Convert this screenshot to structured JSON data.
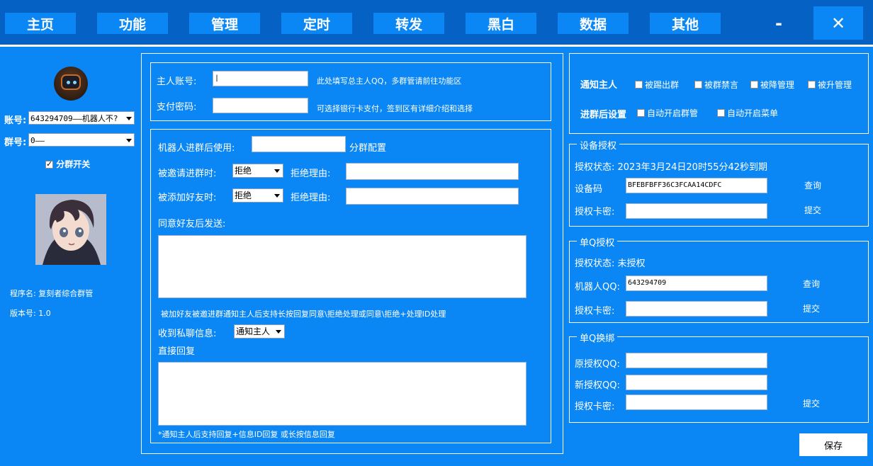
{
  "nav": {
    "tabs": [
      "主页",
      "功能",
      "管理",
      "定时",
      "转发",
      "黑白",
      "数据",
      "其他"
    ],
    "minimize": "-",
    "close": "✕"
  },
  "sidebar": {
    "account_label": "账号:",
    "account_value": "643294709——机器人不?",
    "group_label": "群号:",
    "group_value": "0——",
    "split_switch_label": "分群开关",
    "program_name": "程序名: 复刻者综合群管",
    "version": "版本号: 1.0"
  },
  "owner": {
    "account_label": "主人账号:",
    "account_value": "|",
    "account_hint": "此处填写总主人QQ，多群管请前往功能区",
    "pay_label": "支付密码:",
    "pay_value": "",
    "pay_hint": "可选择银行卡支付，签到区有详细介绍和选择"
  },
  "robot": {
    "after_join_label": "机器人进群后使用:",
    "after_join_value": "",
    "split_config": "分群配置",
    "invited_label": "被邀请进群时:",
    "invited_value": "拒绝",
    "invited_reason_label": "拒绝理由:",
    "invited_reason_value": "",
    "added_label": "被添加好友时:",
    "added_value": "拒绝",
    "added_reason_label": "拒绝理由:",
    "added_reason_value": "",
    "after_agree_label": "同意好友后发送:",
    "after_agree_value": "",
    "hint1": "被加好友被邀进群通知主人后支持长按回复同意\\拒绝处理或同意\\拒绝+处理ID处理",
    "private_msg_label": "收到私聊信息:",
    "private_msg_value": "通知主人",
    "direct_reply_label": "直接回复",
    "direct_reply_value": "",
    "hint2": "*通知主人后支持回复+信息ID回复 或长按信息回复"
  },
  "notify": {
    "notify_owner_label": "通知主人",
    "options": [
      {
        "label": "被踢出群",
        "checked": false
      },
      {
        "label": "被群禁言",
        "checked": false
      },
      {
        "label": "被降管理",
        "checked": false
      },
      {
        "label": "被升管理",
        "checked": false
      }
    ],
    "after_join_label": "进群后设置",
    "after_options": [
      {
        "label": "自动开启群管",
        "checked": false
      },
      {
        "label": "自动开启菜单",
        "checked": false
      }
    ]
  },
  "device_auth": {
    "title": "设备授权",
    "status": "授权状态: 2023年3月24日20时55分42秒到期",
    "device_code_label": "设备码",
    "device_code_value": "BFEBFBFF36C3FCAA14CDFC",
    "query_label": "查询",
    "card_label": "授权卡密:",
    "card_value": "",
    "submit_label": "提交"
  },
  "single_q_auth": {
    "title": "单Q授权",
    "status": "授权状态: 未授权",
    "robot_qq_label": "机器人QQ:",
    "robot_qq_value": "643294709",
    "query_label": "查询",
    "card_label": "授权卡密:",
    "card_value": "",
    "submit_label": "提交"
  },
  "single_q_rebind": {
    "title": "单Q换绑",
    "old_qq_label": "原授权QQ:",
    "old_qq_value": "",
    "new_qq_label": "新授权QQ:",
    "new_qq_value": "",
    "card_label": "授权卡密:",
    "card_value": "",
    "submit_label": "提交"
  },
  "save_label": "保存",
  "colors": {
    "background": "#0a86f5",
    "topbar": "#0562c4",
    "text": "#ffffff"
  }
}
